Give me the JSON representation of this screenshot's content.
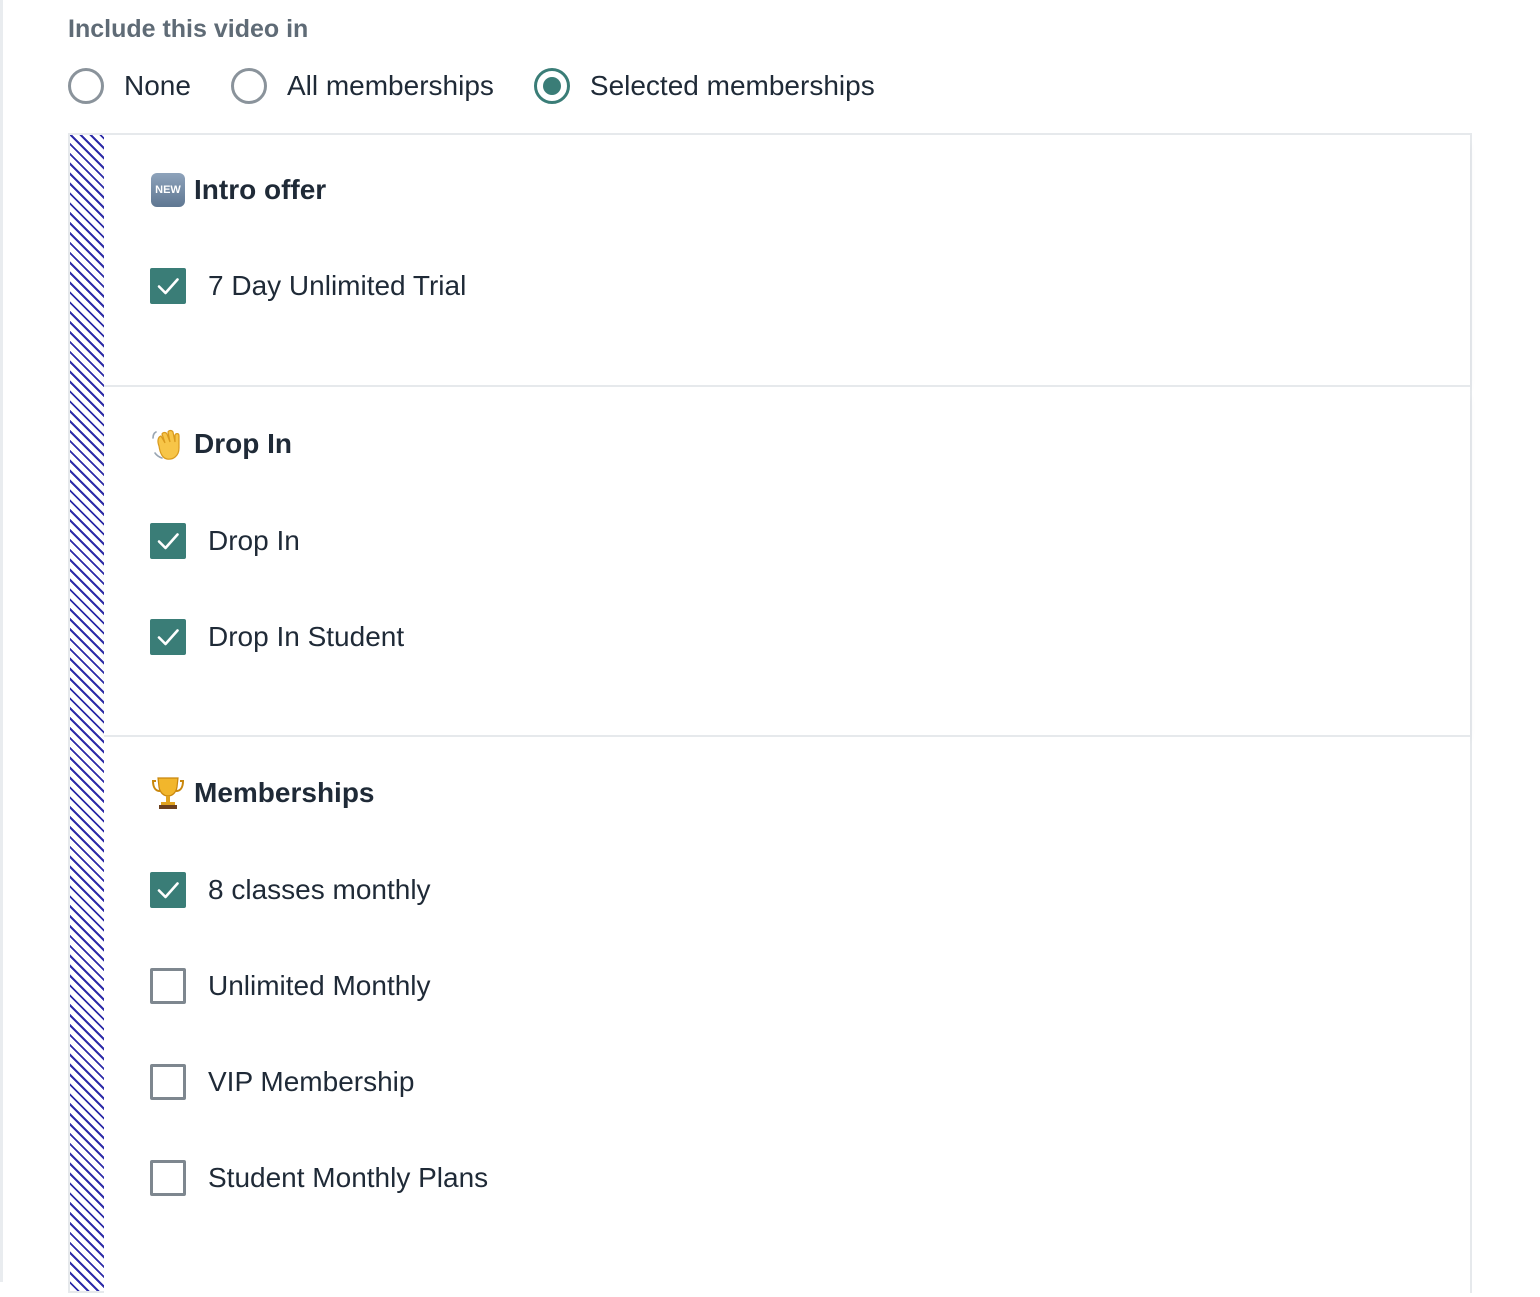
{
  "field_label": "Include this video in",
  "access_options": [
    {
      "label": "None",
      "selected": false
    },
    {
      "label": "All memberships",
      "selected": false
    },
    {
      "label": "Selected memberships",
      "selected": true
    }
  ],
  "groups": [
    {
      "title": "Intro offer",
      "icon": "new-badge-icon",
      "icon_text": "NEW",
      "items": [
        {
          "label": "7 Day Unlimited Trial",
          "checked": true
        }
      ]
    },
    {
      "title": "Drop In",
      "icon": "waving-hand-icon",
      "items": [
        {
          "label": "Drop In",
          "checked": true
        },
        {
          "label": "Drop In Student",
          "checked": true
        }
      ]
    },
    {
      "title": "Memberships",
      "icon": "trophy-icon",
      "items": [
        {
          "label": "8 classes monthly",
          "checked": true
        },
        {
          "label": "Unlimited Monthly",
          "checked": false
        },
        {
          "label": "VIP Membership",
          "checked": false
        },
        {
          "label": "Student Monthly Plans",
          "checked": false
        }
      ]
    }
  ],
  "colors": {
    "accent": "#3a7d77",
    "label_gray": "#5f6b76",
    "text": "#1f2a37",
    "hatch": "#2d2ba8"
  }
}
